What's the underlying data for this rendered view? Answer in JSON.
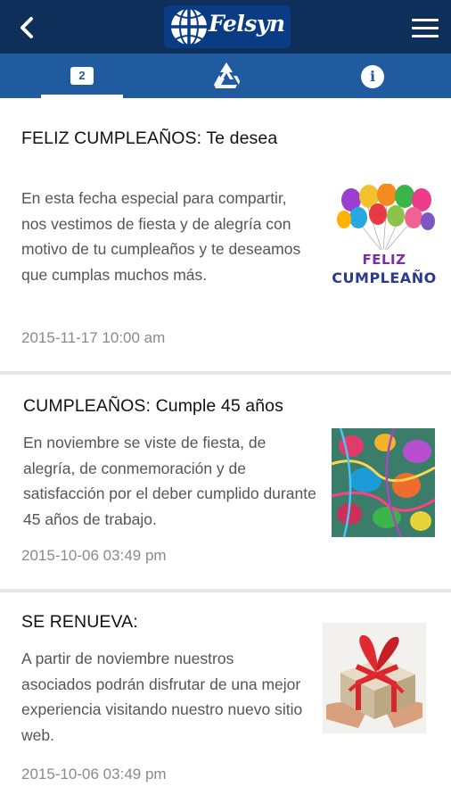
{
  "app": {
    "logo_text": "Felsyn"
  },
  "tabs": [
    {
      "badge": "2",
      "icon": "notifications-icon"
    },
    {
      "icon": "recycle-icon"
    },
    {
      "icon": "info-icon",
      "glyph": "i"
    }
  ],
  "icons": {
    "back": "back-arrow-icon",
    "menu": "hamburger-menu-icon"
  },
  "colors": {
    "appbar": "#0d2f5a",
    "tabbar": "#1f5b9e",
    "text_body": "#555555",
    "text_date": "#8a8a8a"
  },
  "feed": [
    {
      "title": "FELIZ CUMPLEAÑOS: Te desea",
      "body": "En esta fecha especial para compartir, nos vestimos de fiesta y de alegría con motivo de tu cumpleaños y te deseamos que cumplas muchos más.",
      "date": "2015-11-17 10:00 am",
      "image_text_1": "FELIZ",
      "image_text_2": "CUMPLEAÑO"
    },
    {
      "title": "CUMPLEAÑOS:  Cumple 45 años",
      "body": "En noviembre  se viste de fiesta, de alegría, de conmemoración y de satisfacción por el deber cumplido durante 45 años de trabajo.",
      "date": "2015-10-06 03:49 pm"
    },
    {
      "title": "SE RENUEVA:",
      "body": "A partir de noviembre nuestros asociados podrán disfrutar de una mejor experiencia visitando nuestro nuevo sitio web.",
      "date": "2015-10-06 03:49 pm"
    }
  ]
}
